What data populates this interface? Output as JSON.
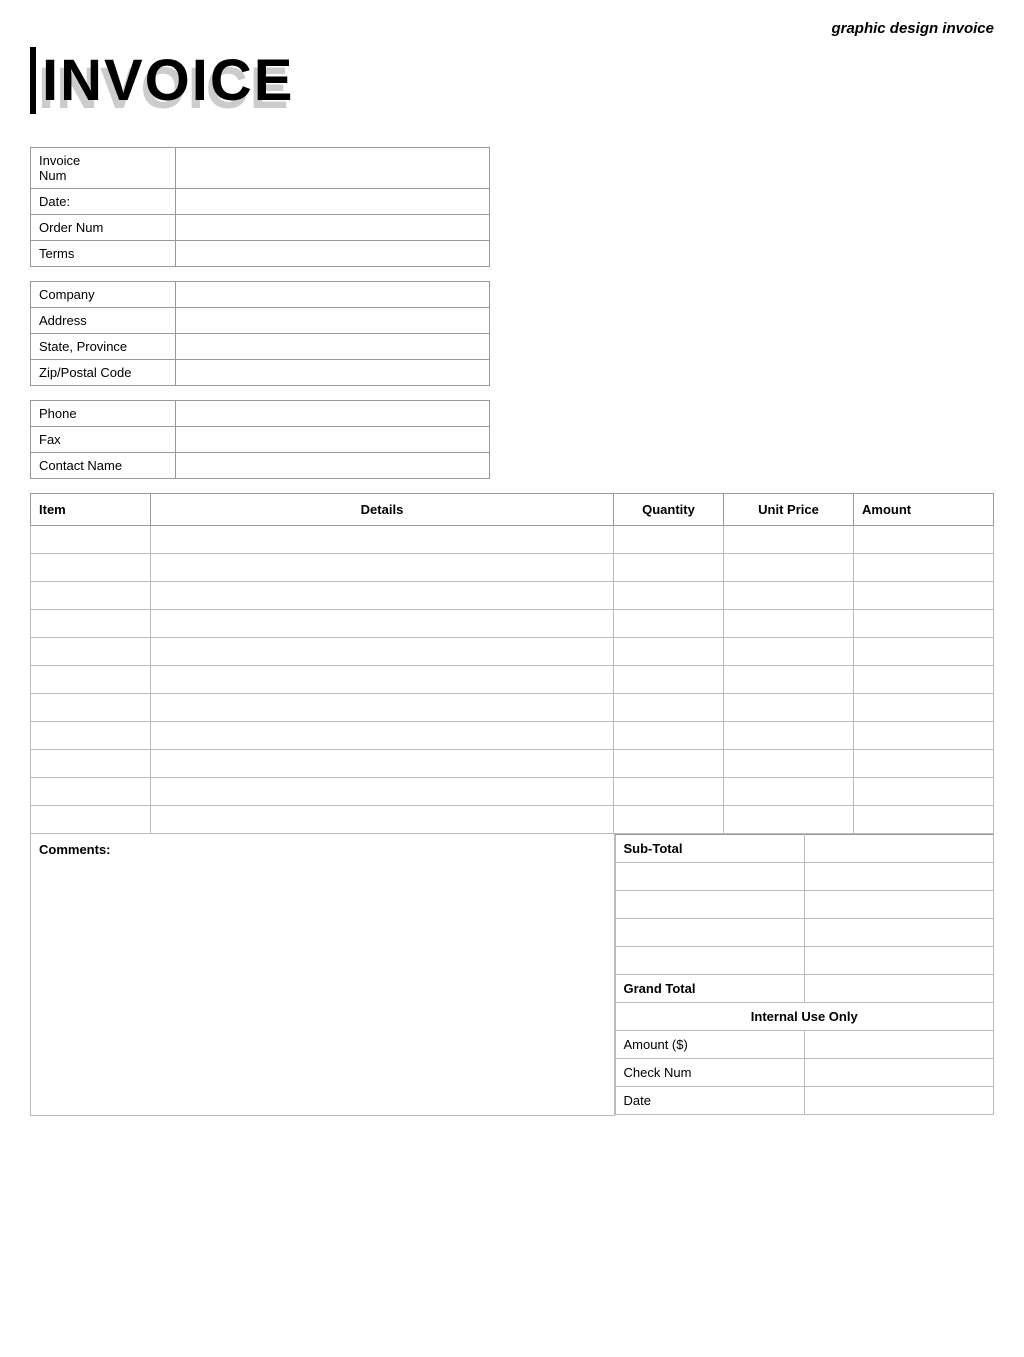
{
  "page": {
    "header_title": "graphic design invoice",
    "invoice_title_shadow": "INVOICE",
    "invoice_title_main": "INVOICE"
  },
  "invoice_info": {
    "fields": [
      {
        "label": "Invoice Num",
        "value": ""
      },
      {
        "label": "Date:",
        "value": ""
      },
      {
        "label": "Order Num",
        "value": ""
      },
      {
        "label": "Terms",
        "value": ""
      }
    ]
  },
  "company_info": {
    "fields": [
      {
        "label": "Company",
        "value": ""
      },
      {
        "label": "Address",
        "value": ""
      },
      {
        "label": "State, Province",
        "value": ""
      },
      {
        "label": "Zip/Postal Code",
        "value": ""
      }
    ]
  },
  "contact_info": {
    "fields": [
      {
        "label": "Phone",
        "value": ""
      },
      {
        "label": "Fax",
        "value": ""
      },
      {
        "label": "Contact Name",
        "value": ""
      }
    ]
  },
  "items_table": {
    "headers": [
      "Item",
      "Details",
      "Quantity",
      "Unit Price",
      "Amount"
    ],
    "rows": [
      {
        "item": "",
        "details": "",
        "quantity": "",
        "unit_price": "",
        "amount": ""
      },
      {
        "item": "",
        "details": "",
        "quantity": "",
        "unit_price": "",
        "amount": ""
      },
      {
        "item": "",
        "details": "",
        "quantity": "",
        "unit_price": "",
        "amount": ""
      },
      {
        "item": "",
        "details": "",
        "quantity": "",
        "unit_price": "",
        "amount": ""
      },
      {
        "item": "",
        "details": "",
        "quantity": "",
        "unit_price": "",
        "amount": ""
      },
      {
        "item": "",
        "details": "",
        "quantity": "",
        "unit_price": "",
        "amount": ""
      },
      {
        "item": "",
        "details": "",
        "quantity": "",
        "unit_price": "",
        "amount": ""
      },
      {
        "item": "",
        "details": "",
        "quantity": "",
        "unit_price": "",
        "amount": ""
      },
      {
        "item": "",
        "details": "",
        "quantity": "",
        "unit_price": "",
        "amount": ""
      },
      {
        "item": "",
        "details": "",
        "quantity": "",
        "unit_price": "",
        "amount": ""
      },
      {
        "item": "",
        "details": "",
        "quantity": "",
        "unit_price": "",
        "amount": ""
      }
    ]
  },
  "comments_label": "Comments:",
  "totals": {
    "subtotal_label": "Sub-Total",
    "subtotal_value": "",
    "extra_rows": [
      {
        "label": "",
        "value": ""
      },
      {
        "label": "",
        "value": ""
      },
      {
        "label": "",
        "value": ""
      },
      {
        "label": "",
        "value": ""
      }
    ],
    "grand_total_label": "Grand Total",
    "grand_total_value": "",
    "internal_use_label": "Internal Use Only",
    "internal_rows": [
      {
        "label": "Amount ($)",
        "value": ""
      },
      {
        "label": "Check Num",
        "value": ""
      },
      {
        "label": "Date",
        "value": ""
      }
    ]
  }
}
